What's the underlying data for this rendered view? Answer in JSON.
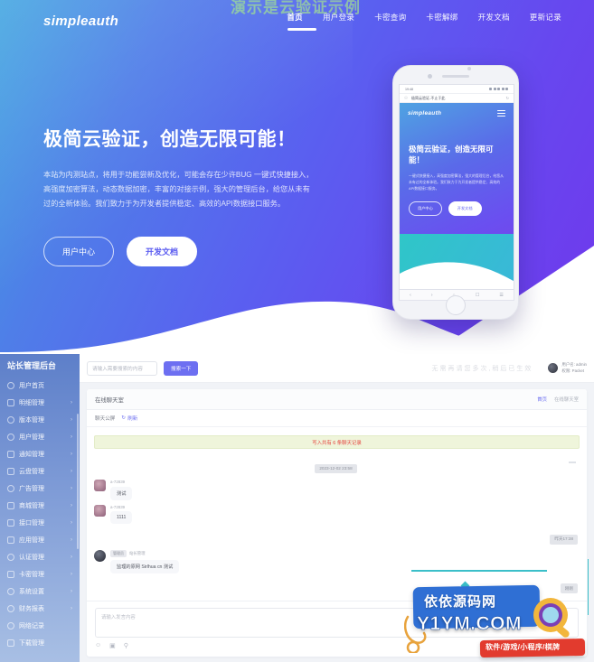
{
  "site": {
    "brand": "simpleauth",
    "ghost_overlay_text": "演示是云验证示例"
  },
  "nav": {
    "items": [
      {
        "label": "首页",
        "active": true
      },
      {
        "label": "用户登录",
        "active": false
      },
      {
        "label": "卡密查询",
        "active": false
      },
      {
        "label": "卡密解绑",
        "active": false
      },
      {
        "label": "开发文档",
        "active": false
      },
      {
        "label": "更新记录",
        "active": false
      }
    ]
  },
  "hero": {
    "headline": "极简云验证，创造无限可能！",
    "paragraph": "本站为内测站点，将用于功能尝新及优化，可能会存在少许BUG 一键式快捷接入，高强度加密算法，动态数据加密，丰富的对接示例，强大的管理后台，给您从未有过的全新体验。我们致力于为开发者提供稳定、高效的API数据接口服务。",
    "btn_primary": "用户中心",
    "btn_secondary": "开发文档"
  },
  "phone": {
    "status_time": "19:48",
    "url_text": "极简云验证-不止于此",
    "brand": "simpleauth",
    "headline": "极简云验证，创造无限可能！",
    "paragraph": "一键式快捷接入，高强度加密算法，强大的管理后台，给您从未有过的全新体验。我们致力于为开发者提供稳定、高效的API数据接口服务。",
    "btn_primary": "用户中心",
    "btn_secondary": "开发文档",
    "toolbar_icons": [
      "back-icon",
      "forward-icon",
      "home-icon",
      "window-icon",
      "menu-icon"
    ]
  },
  "admin": {
    "sidebar": {
      "title": "站长管理后台",
      "items": [
        {
          "label": "用户首页",
          "icon": "home-icon",
          "arrow": false
        },
        {
          "label": "明细管理",
          "icon": "list-icon",
          "arrow": true
        },
        {
          "label": "版本管理",
          "icon": "layers-icon",
          "arrow": true
        },
        {
          "label": "用户管理",
          "icon": "user-icon",
          "arrow": true
        },
        {
          "label": "通知管理",
          "icon": "bell-icon",
          "arrow": true
        },
        {
          "label": "云盘管理",
          "icon": "cloud-icon",
          "arrow": true
        },
        {
          "label": "广告管理",
          "icon": "ad-icon",
          "arrow": true
        },
        {
          "label": "商城管理",
          "icon": "cart-icon",
          "arrow": true
        },
        {
          "label": "接口管理",
          "icon": "plug-icon",
          "arrow": true
        },
        {
          "label": "应用管理",
          "icon": "apps-icon",
          "arrow": true
        },
        {
          "label": "认证管理",
          "icon": "shield-icon",
          "arrow": true
        },
        {
          "label": "卡密管理",
          "icon": "key-icon",
          "arrow": true
        },
        {
          "label": "系统设置",
          "icon": "gear-icon",
          "arrow": true
        },
        {
          "label": "财务报表",
          "icon": "chart-icon",
          "arrow": true
        },
        {
          "label": "网络记录",
          "icon": "globe-icon",
          "arrow": false
        },
        {
          "label": "下载管理",
          "icon": "download-icon",
          "arrow": false
        }
      ]
    },
    "topbar": {
      "search_placeholder": "请输入需要搜索的内容",
      "search_value": "",
      "search_button": "搜索一下",
      "ghost_text": "无需再请您多次,稍后已生效",
      "user_name": "用户名: admin",
      "user_role": "权限: Packet"
    },
    "panel": {
      "title": "在线聊天室",
      "links": [
        "首页",
        "在线聊天室"
      ],
      "subbar_label": "聊天公屏",
      "refresh_label": "刷新",
      "notice": "写入共有 6 条聊天记录"
    },
    "chat": {
      "timestamps": [
        "2023-12-02 23:58",
        "昨天17:38",
        "刚刚"
      ],
      "messages": [
        {
          "who": "a-72839",
          "tag": "",
          "text": "测试",
          "avatar": "user-avatar"
        },
        {
          "who": "a-72839",
          "tag": "",
          "text": "1111",
          "avatar": "user-avatar"
        },
        {
          "who": "站长管理",
          "tag": "管理员",
          "text": "监理的原网 Sirlhua cn 测试",
          "avatar": "admin-avatar"
        }
      ]
    },
    "composer": {
      "placeholder": "请输入发言内容",
      "value": "",
      "tools": [
        "emoji-icon",
        "image-icon",
        "search-icon"
      ]
    }
  },
  "watermark": {
    "cn": "依依源码网",
    "en": "Y1YM.COM",
    "tags": "软件/游戏/小程序/棋牌"
  },
  "colors": {
    "hero_start": "#3ea4e0",
    "hero_end": "#7038ec",
    "accent": "#6d6ff1",
    "notice_text": "#e5403a",
    "sidebar_top": "#5d7fc9"
  }
}
